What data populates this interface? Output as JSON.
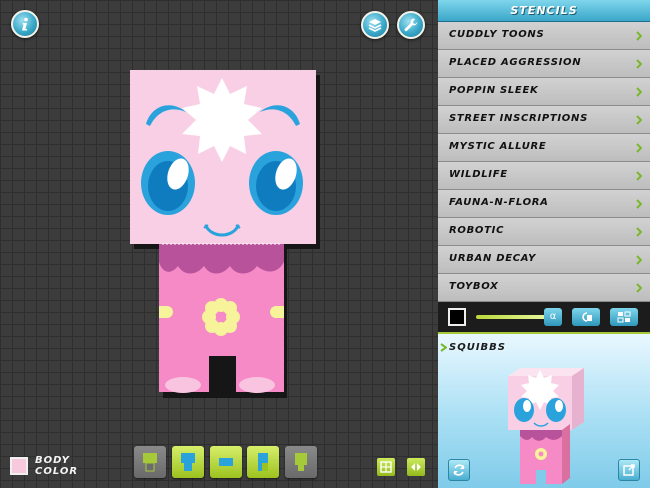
{
  "canvas": {
    "info_icon": "info-icon",
    "layers_icon": "layers-icon",
    "settings_icon": "wrench-icon"
  },
  "bottom_bar": {
    "body_color_label_1": "BODY",
    "body_color_label_2": "COLOR",
    "body_color": "#f8c8dc",
    "part_buttons": [
      "head-only",
      "full-body",
      "torso",
      "legs",
      "shading"
    ],
    "grid_toggle_icon": "grid-icon",
    "flip_icon": "flip-icon"
  },
  "panel": {
    "header": "STENCILS",
    "stencils": [
      "CUDDLY TOONS",
      "PLACED AGGRESSION",
      "POPPIN SLEEK",
      "STREET INSCRIPTIONS",
      "MYSTIC ALLURE",
      "WILDLIFE",
      "FAUNA-N-FLORA",
      "ROBOTIC",
      "URBAN DECAY",
      "TOYBOX"
    ],
    "tools": {
      "selected_color": "#000000",
      "alpha_label": "α",
      "copy_icon": "copy-icon",
      "mirror_icon": "mirror-icon"
    },
    "preview": {
      "title": "SQUIBBS",
      "rotate_icon": "rotate-icon",
      "export_icon": "export-icon"
    }
  },
  "colors": {
    "accent_blue": "#3aa6c9",
    "accent_green": "#a6c93a",
    "body_pink": "#f6c3df",
    "legs_pink": "#f58ac6"
  }
}
